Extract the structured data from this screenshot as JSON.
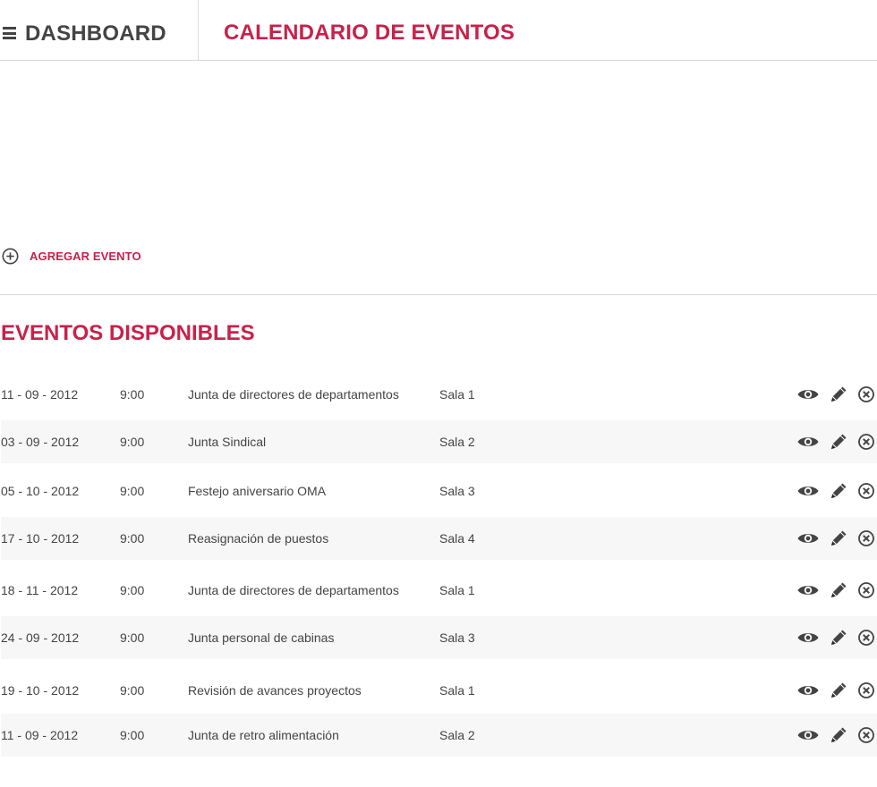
{
  "header": {
    "dashboard_title": "DASHBOARD",
    "page_title": "CALENDARIO DE EVENTOS",
    "menu_icon": "hamburger-menu-icon"
  },
  "add_event": {
    "label": "AGREGAR EVENTO",
    "icon": "plus-circle-icon"
  },
  "events_section": {
    "title": "EVENTOS DISPONIBLES",
    "action_icons": [
      "eye-icon",
      "pencil-icon",
      "close-circle-icon"
    ],
    "rows": [
      {
        "date": "11 - 09 - 2012",
        "time": "9:00",
        "description": "Junta de directores de departamentos",
        "room": "Sala 1"
      },
      {
        "date": "03 - 09 - 2012",
        "time": "9:00",
        "description": "Junta Sindical",
        "room": "Sala 2"
      },
      {
        "date": "05 - 10 - 2012",
        "time": "9:00",
        "description": "Festejo aniversario OMA",
        "room": "Sala 3"
      },
      {
        "date": "17 - 10 - 2012",
        "time": "9:00",
        "description": "Reasignación de puestos",
        "room": "Sala 4"
      },
      {
        "date": "18 - 11 - 2012",
        "time": "9:00",
        "description": "Junta de directores de departamentos",
        "room": "Sala 1"
      },
      {
        "date": "24 - 09 - 2012",
        "time": "9:00",
        "description": "Junta personal de cabinas",
        "room": "Sala 3"
      },
      {
        "date": "19 - 10 - 2012",
        "time": "9:00",
        "description": "Revisión de avances proyectos",
        "room": "Sala 1"
      },
      {
        "date": "11 - 09 - 2012",
        "time": "9:00",
        "description": "Junta de retro alimentación",
        "room": "Sala 2"
      }
    ]
  },
  "colors": {
    "accent": "#c8214a",
    "text": "#444444",
    "divider": "#d9d9d9",
    "row_alt": "#f7f7f7"
  }
}
